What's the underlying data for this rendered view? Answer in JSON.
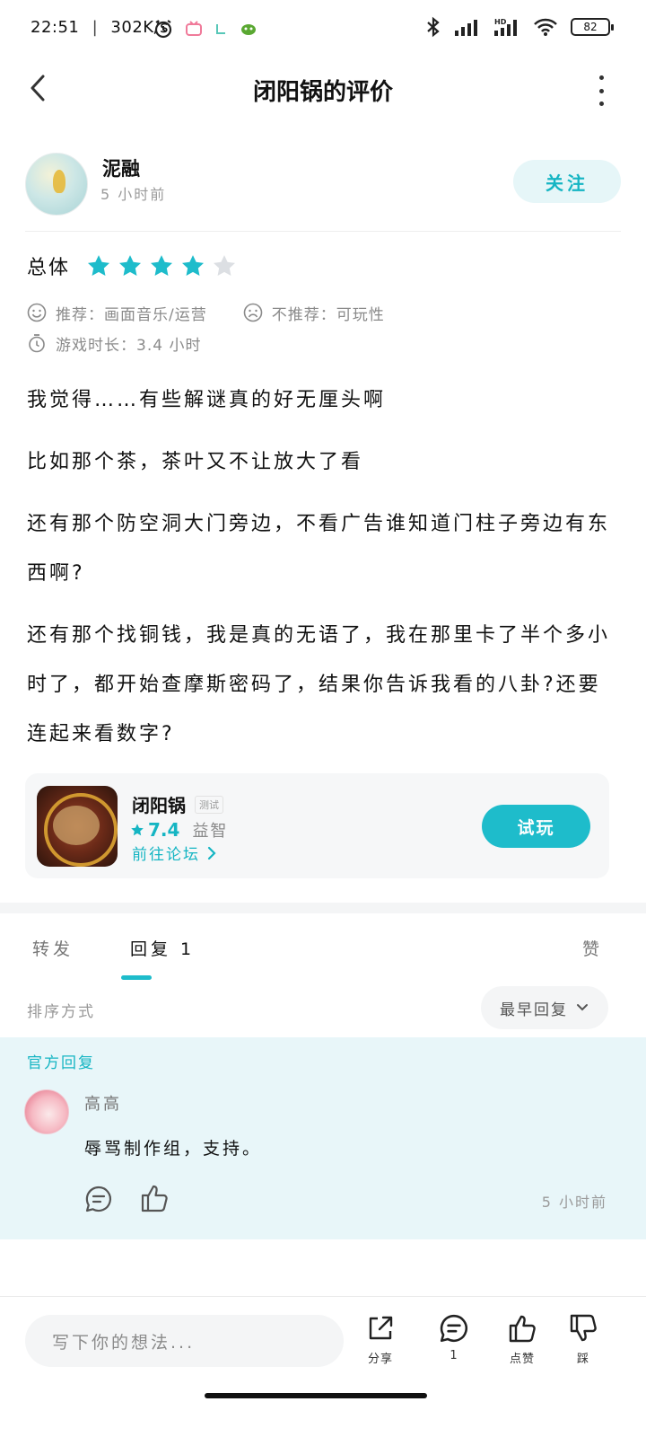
{
  "status_bar": {
    "time": "22:51",
    "speed": "302K/s",
    "battery": "82"
  },
  "nav": {
    "title": "闭阳锅的评价"
  },
  "author": {
    "name": "泥融",
    "time": "5 小时前",
    "follow_label": "关注"
  },
  "rating": {
    "label": "总体",
    "stars_filled": 4,
    "stars_total": 5
  },
  "recommend": {
    "recommend_text": "推荐：画面音乐/运营",
    "not_recommend_text": "不推荐：可玩性",
    "playtime_text": "游戏时长：3.4 小时"
  },
  "content": {
    "paragraphs": [
      "我觉得……有些解谜真的好无厘头啊",
      "比如那个茶，茶叶又不让放大了看",
      "还有那个防空洞大门旁边，不看广告谁知道门柱子旁边有东西啊?",
      "还有那个找铜钱，我是真的无语了，我在那里卡了半个多小时了，都开始查摩斯密码了，结果你告诉我看的八卦?还要连起来看数字?"
    ]
  },
  "game_card": {
    "name": "闭阳锅",
    "tag": "测试",
    "score": "7.4",
    "genre": "益智",
    "forum_link": "前往论坛",
    "try_label": "试玩"
  },
  "tabs": {
    "repost": "转发",
    "reply": "回复 1",
    "like": "赞"
  },
  "sort": {
    "label": "排序方式",
    "value": "最早回复"
  },
  "official_reply": {
    "section_label": "官方回复",
    "name": "高高",
    "text": "辱骂制作组，支持。",
    "time": "5 小时前"
  },
  "bottom_bar": {
    "input_placeholder": "写下你的想法...",
    "share_label": "分享",
    "comment_count": "1",
    "like_label": "点赞",
    "dislike_label": "踩"
  },
  "colors": {
    "accent": "#1ebccb",
    "accent_text": "#15b5c3",
    "official_bg": "#e8f6f9",
    "star_empty": "#dcdfe3"
  }
}
